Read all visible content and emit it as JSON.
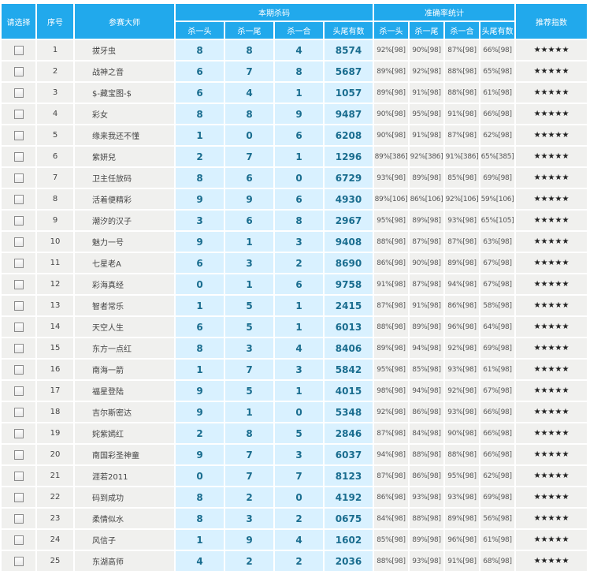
{
  "headers": {
    "select": "请选择",
    "seq": "序号",
    "master": "参赛大师",
    "kill_group": "本期杀码",
    "accuracy_group": "准确率统计",
    "recommend": "推荐指数",
    "kill_cols": [
      "杀一头",
      "杀一尾",
      "杀一合",
      "头尾有数"
    ],
    "acc_cols": [
      "杀一头",
      "杀一尾",
      "杀一合",
      "头尾有数"
    ]
  },
  "rows": [
    {
      "seq": "1",
      "name": "拔牙虫",
      "k1": "8",
      "k2": "8",
      "k3": "4",
      "tw": "8574",
      "a1": "92%[98]",
      "a2": "90%[98]",
      "a3": "87%[98]",
      "a4": "66%[98]",
      "stars": "★★★★★"
    },
    {
      "seq": "2",
      "name": "战神之音",
      "k1": "6",
      "k2": "7",
      "k3": "8",
      "tw": "5687",
      "a1": "89%[98]",
      "a2": "92%[98]",
      "a3": "88%[98]",
      "a4": "65%[98]",
      "stars": "★★★★★"
    },
    {
      "seq": "3",
      "name": "$-藏宝图-$",
      "k1": "6",
      "k2": "4",
      "k3": "1",
      "tw": "1057",
      "a1": "89%[98]",
      "a2": "91%[98]",
      "a3": "88%[98]",
      "a4": "61%[98]",
      "stars": "★★★★★"
    },
    {
      "seq": "4",
      "name": "彩女",
      "k1": "8",
      "k2": "8",
      "k3": "9",
      "tw": "9487",
      "a1": "90%[98]",
      "a2": "95%[98]",
      "a3": "91%[98]",
      "a4": "66%[98]",
      "stars": "★★★★★"
    },
    {
      "seq": "5",
      "name": "缘来我还不懂",
      "k1": "1",
      "k2": "0",
      "k3": "6",
      "tw": "6208",
      "a1": "90%[98]",
      "a2": "91%[98]",
      "a3": "87%[98]",
      "a4": "62%[98]",
      "stars": "★★★★★"
    },
    {
      "seq": "6",
      "name": "紫妍兒",
      "k1": "2",
      "k2": "7",
      "k3": "1",
      "tw": "1296",
      "a1": "89%[386]",
      "a2": "92%[386]",
      "a3": "91%[386]",
      "a4": "65%[385]",
      "stars": "★★★★★"
    },
    {
      "seq": "7",
      "name": "卫主任放码",
      "k1": "8",
      "k2": "6",
      "k3": "0",
      "tw": "6729",
      "a1": "93%[98]",
      "a2": "89%[98]",
      "a3": "85%[98]",
      "a4": "69%[98]",
      "stars": "★★★★★"
    },
    {
      "seq": "8",
      "name": "活着便精彩",
      "k1": "9",
      "k2": "9",
      "k3": "6",
      "tw": "4930",
      "a1": "89%[106]",
      "a2": "86%[106]",
      "a3": "92%[106]",
      "a4": "59%[106]",
      "stars": "★★★★★"
    },
    {
      "seq": "9",
      "name": "潮汐的汉子",
      "k1": "3",
      "k2": "6",
      "k3": "8",
      "tw": "2967",
      "a1": "95%[98]",
      "a2": "89%[98]",
      "a3": "93%[98]",
      "a4": "65%[105]",
      "stars": "★★★★★"
    },
    {
      "seq": "10",
      "name": "魅力一号",
      "k1": "9",
      "k2": "1",
      "k3": "3",
      "tw": "9408",
      "a1": "88%[98]",
      "a2": "87%[98]",
      "a3": "87%[98]",
      "a4": "63%[98]",
      "stars": "★★★★★"
    },
    {
      "seq": "11",
      "name": "七星老A",
      "k1": "6",
      "k2": "3",
      "k3": "2",
      "tw": "8690",
      "a1": "86%[98]",
      "a2": "90%[98]",
      "a3": "89%[98]",
      "a4": "67%[98]",
      "stars": "★★★★★"
    },
    {
      "seq": "12",
      "name": "彩海真经",
      "k1": "0",
      "k2": "1",
      "k3": "6",
      "tw": "9758",
      "a1": "91%[98]",
      "a2": "87%[98]",
      "a3": "94%[98]",
      "a4": "67%[98]",
      "stars": "★★★★★"
    },
    {
      "seq": "13",
      "name": "智者常乐",
      "k1": "1",
      "k2": "5",
      "k3": "1",
      "tw": "2415",
      "a1": "87%[98]",
      "a2": "91%[98]",
      "a3": "86%[98]",
      "a4": "58%[98]",
      "stars": "★★★★★"
    },
    {
      "seq": "14",
      "name": "天空人生",
      "k1": "6",
      "k2": "5",
      "k3": "1",
      "tw": "6013",
      "a1": "88%[98]",
      "a2": "89%[98]",
      "a3": "96%[98]",
      "a4": "64%[98]",
      "stars": "★★★★★"
    },
    {
      "seq": "15",
      "name": "东方一点红",
      "k1": "8",
      "k2": "3",
      "k3": "4",
      "tw": "8406",
      "a1": "89%[98]",
      "a2": "94%[98]",
      "a3": "92%[98]",
      "a4": "69%[98]",
      "stars": "★★★★★"
    },
    {
      "seq": "16",
      "name": "南海一箭",
      "k1": "1",
      "k2": "7",
      "k3": "3",
      "tw": "5842",
      "a1": "95%[98]",
      "a2": "85%[98]",
      "a3": "93%[98]",
      "a4": "61%[98]",
      "stars": "★★★★★"
    },
    {
      "seq": "17",
      "name": "福星登陆",
      "k1": "9",
      "k2": "5",
      "k3": "1",
      "tw": "4015",
      "a1": "98%[98]",
      "a2": "94%[98]",
      "a3": "92%[98]",
      "a4": "67%[98]",
      "stars": "★★★★★"
    },
    {
      "seq": "18",
      "name": "吉尔斯密达",
      "k1": "9",
      "k2": "1",
      "k3": "0",
      "tw": "5348",
      "a1": "92%[98]",
      "a2": "86%[98]",
      "a3": "93%[98]",
      "a4": "66%[98]",
      "stars": "★★★★★"
    },
    {
      "seq": "19",
      "name": "姹紫嫣红",
      "k1": "2",
      "k2": "8",
      "k3": "5",
      "tw": "2846",
      "a1": "87%[98]",
      "a2": "84%[98]",
      "a3": "90%[98]",
      "a4": "66%[98]",
      "stars": "★★★★★"
    },
    {
      "seq": "20",
      "name": "南国彩圣神童",
      "k1": "9",
      "k2": "7",
      "k3": "3",
      "tw": "6037",
      "a1": "94%[98]",
      "a2": "88%[98]",
      "a3": "88%[98]",
      "a4": "66%[98]",
      "stars": "★★★★★"
    },
    {
      "seq": "21",
      "name": "涯若2011",
      "k1": "0",
      "k2": "7",
      "k3": "7",
      "tw": "8123",
      "a1": "87%[98]",
      "a2": "86%[98]",
      "a3": "95%[98]",
      "a4": "62%[98]",
      "stars": "★★★★★"
    },
    {
      "seq": "22",
      "name": "码到成功",
      "k1": "8",
      "k2": "2",
      "k3": "0",
      "tw": "4192",
      "a1": "86%[98]",
      "a2": "93%[98]",
      "a3": "93%[98]",
      "a4": "69%[98]",
      "stars": "★★★★★"
    },
    {
      "seq": "23",
      "name": "柔情似水",
      "k1": "8",
      "k2": "3",
      "k3": "2",
      "tw": "0675",
      "a1": "84%[98]",
      "a2": "88%[98]",
      "a3": "89%[98]",
      "a4": "56%[98]",
      "stars": "★★★★★"
    },
    {
      "seq": "24",
      "name": "风信子",
      "k1": "1",
      "k2": "9",
      "k3": "4",
      "tw": "1602",
      "a1": "85%[98]",
      "a2": "89%[98]",
      "a3": "96%[98]",
      "a4": "61%[98]",
      "stars": "★★★★★"
    },
    {
      "seq": "25",
      "name": "东湖高师",
      "k1": "4",
      "k2": "2",
      "k3": "2",
      "tw": "2036",
      "a1": "88%[98]",
      "a2": "93%[98]",
      "a3": "91%[98]",
      "a4": "68%[98]",
      "stars": "★★★★★"
    }
  ]
}
